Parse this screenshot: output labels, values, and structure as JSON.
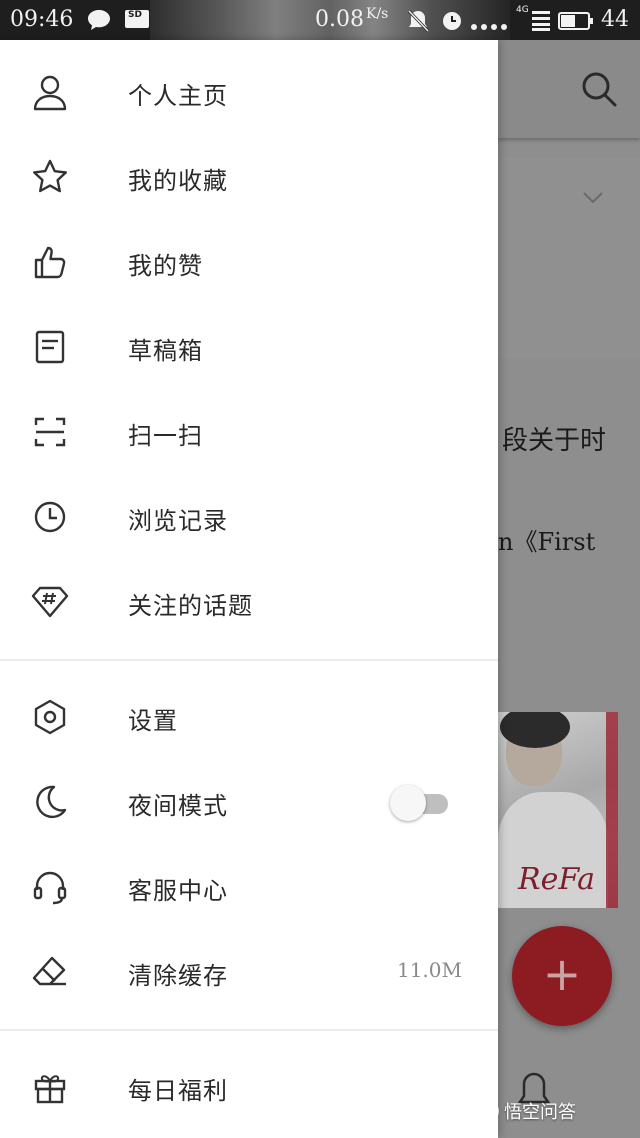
{
  "status_bar": {
    "time": "09:46",
    "speed": "0.08",
    "speed_unit": "K/s",
    "network": "4G",
    "battery": "44",
    "sd_label": "SD"
  },
  "drawer": {
    "menu_top": [
      {
        "label": "个人主页",
        "icon": "user-icon"
      },
      {
        "label": "我的收藏",
        "icon": "star-icon"
      },
      {
        "label": "我的赞",
        "icon": "thumbs-up-icon"
      },
      {
        "label": "草稿箱",
        "icon": "draft-icon"
      },
      {
        "label": "扫一扫",
        "icon": "scan-icon"
      },
      {
        "label": "浏览记录",
        "icon": "history-clock-icon"
      },
      {
        "label": "关注的话题",
        "icon": "topic-hashtag-icon"
      }
    ],
    "menu_settings": [
      {
        "label": "设置",
        "icon": "settings-hexagon-icon"
      },
      {
        "label": "夜间模式",
        "icon": "moon-icon",
        "toggle_on": false
      },
      {
        "label": "客服中心",
        "icon": "headset-icon"
      },
      {
        "label": "清除缓存",
        "icon": "eraser-icon",
        "value": "11.0M"
      }
    ],
    "menu_bottom": [
      {
        "label": "每日福利",
        "icon": "gift-icon"
      }
    ]
  },
  "background": {
    "text_line1": "段关于时",
    "text_line2": "n《First",
    "photo_brand": "ReFa",
    "fab_label": "+",
    "watermark": "悟空问答"
  },
  "colors": {
    "fab": "#8d1b22",
    "drawer_bg": "#ffffff",
    "scrim": "#8e8e8e"
  }
}
